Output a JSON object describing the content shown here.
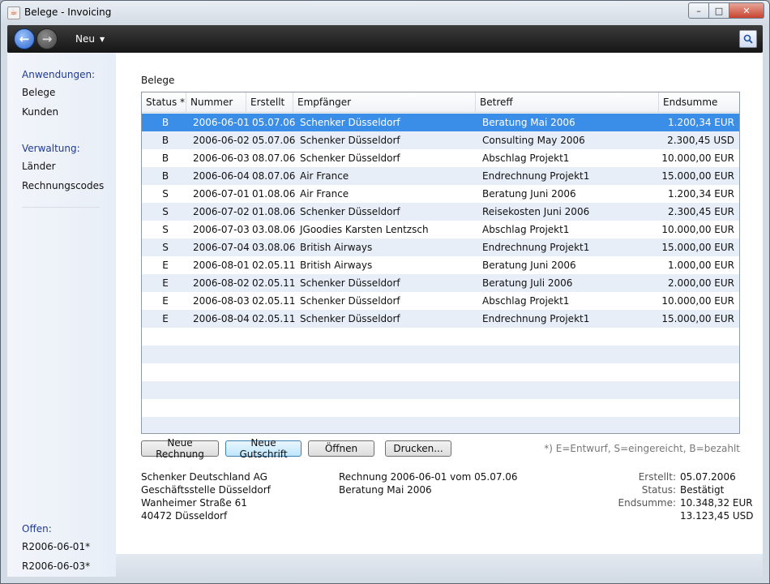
{
  "window": {
    "title": "Belege - Invoicing",
    "app_icon_glyph": "☕"
  },
  "window_controls": {
    "min": "–",
    "max": "□",
    "close": "✕"
  },
  "toolbar": {
    "neu_label": "Neu",
    "search_icon": "search-icon"
  },
  "sidebar": {
    "anwendungen_header": "Anwendungen:",
    "belege": "Belege",
    "kunden": "Kunden",
    "verwaltung_header": "Verwaltung:",
    "laender": "Länder",
    "rechnungscodes": "Rechnungscodes",
    "offen_header": "Offen:",
    "offen_items": [
      "R2006-06-01*",
      "R2006-06-03*"
    ]
  },
  "section_title": "Belege",
  "table": {
    "headers": [
      "Status *",
      "Nummer",
      "Erstellt",
      "Empfänger",
      "Betreff",
      "Endsumme"
    ],
    "rows": [
      [
        "B",
        "2006-06-01",
        "05.07.06",
        "Schenker Düsseldorf",
        "Beratung Mai 2006",
        "1.200,34 EUR"
      ],
      [
        "B",
        "2006-06-02",
        "05.07.06",
        "Schenker Düsseldorf",
        "Consulting May 2006",
        "2.300,45 USD"
      ],
      [
        "B",
        "2006-06-03",
        "08.07.06",
        "Schenker Düsseldorf",
        "Abschlag Projekt1",
        "10.000,00 EUR"
      ],
      [
        "B",
        "2006-06-04",
        "08.07.06",
        "Air France",
        "Endrechnung Projekt1",
        "15.000,00 EUR"
      ],
      [
        "S",
        "2006-07-01",
        "01.08.06",
        "Air France",
        "Beratung Juni 2006",
        "1.200,34 EUR"
      ],
      [
        "S",
        "2006-07-02",
        "01.08.06",
        "Schenker Düsseldorf",
        "Reisekosten Juni 2006",
        "2.300,45 EUR"
      ],
      [
        "S",
        "2006-07-03",
        "03.08.06",
        "JGoodies Karsten Lentzsch",
        "Abschlag Projekt1",
        "10.000,00 EUR"
      ],
      [
        "S",
        "2006-07-04",
        "03.08.06",
        "British Airways",
        "Endrechnung Projekt1",
        "15.000,00 EUR"
      ],
      [
        "E",
        "2006-08-01",
        "02.05.11",
        "British Airways",
        "Beratung Juni 2006",
        "1.000,00 EUR"
      ],
      [
        "E",
        "2006-08-02",
        "02.05.11",
        "Schenker Düsseldorf",
        "Beratung Juli 2006",
        "2.000,00 EUR"
      ],
      [
        "E",
        "2006-08-03",
        "02.05.11",
        "Schenker Düsseldorf",
        "Abschlag Projekt1",
        "10.000,00 EUR"
      ],
      [
        "E",
        "2006-08-04",
        "02.05.11",
        "Schenker Düsseldorf",
        "Endrechnung Projekt1",
        "15.000,00 EUR"
      ]
    ],
    "selected_row": 0
  },
  "buttons": {
    "neue_rechnung": "Neue Rechnung",
    "neue_gutschrift": "Neue Gutschrift",
    "oeffnen": "Öffnen",
    "drucken": "Drucken..."
  },
  "legend": "*) E=Entwurf, S=eingereicht, B=bezahlt",
  "detail": {
    "address": [
      "Schenker Deutschland AG",
      "Geschäftsstelle Düsseldorf",
      "Wanheimer Straße 61",
      "40472 Düsseldorf"
    ],
    "invoice": [
      "Rechnung 2006-06-01 vom 05.07.06",
      "Beratung Mai 2006"
    ],
    "erstellt_label": "Erstellt:",
    "erstellt_value": "05.07.2006",
    "status_label": "Status:",
    "status_value": "Bestätigt",
    "endsumme_label": "Endsumme:",
    "endsumme_value": "10.348,32 EUR",
    "endsumme_value2": "13.123,45 USD"
  }
}
